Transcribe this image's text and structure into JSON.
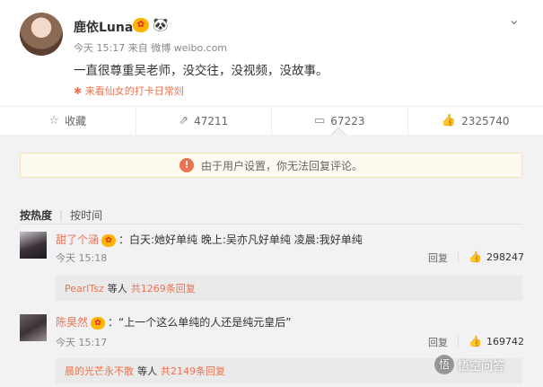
{
  "post": {
    "author": "鹿依Luna",
    "vip_badge": "✿",
    "panda_badge": "🐼",
    "meta": "今天 15:17 来自 微博 weibo.com",
    "content": "一直很尊重吴老师，没交往，没视频，没故事。",
    "tag": "来看仙女的打卡日常剡",
    "tag_icon": "✱",
    "chevron": "⌄"
  },
  "actions": {
    "favorite": {
      "icon": "☆",
      "label": "收藏"
    },
    "repost": {
      "icon": "⇗",
      "label": "47211"
    },
    "comment": {
      "icon": "▭",
      "label": "67223"
    },
    "like": {
      "icon": "👍",
      "label": "2325740"
    }
  },
  "notice": {
    "icon": "!",
    "text": "由于用户设置，你无法回复评论。"
  },
  "sort": {
    "hot": "按热度",
    "sep": "|",
    "time": "按时间"
  },
  "comments": [
    {
      "name": "甜了个涵",
      "vip": "✿",
      "text": "：白天:她好单纯 晚上:吴亦凡好单纯 凌晨:我好单纯",
      "time": "今天 15:18",
      "reply": "回复",
      "likes": "298247",
      "sub_user": "PearlTsz",
      "sub_mid": "等人",
      "sub_count": "共1269条回复"
    },
    {
      "name": "陈昊然",
      "vip": "✿",
      "text": "：“上一个这么单纯的人还是纯元皇后”",
      "time": "今天 15:17",
      "reply": "回复",
      "likes": "169742",
      "sub_user": "晨的光芒永不散",
      "sub_mid": "等人",
      "sub_count": "共2149条回复"
    }
  ],
  "watermark": {
    "logo": "悟",
    "text": "悟空问答"
  },
  "colors": {
    "accent": "#eb7350",
    "vip": "#ffb400",
    "notice_bg": "#fefaf0"
  }
}
